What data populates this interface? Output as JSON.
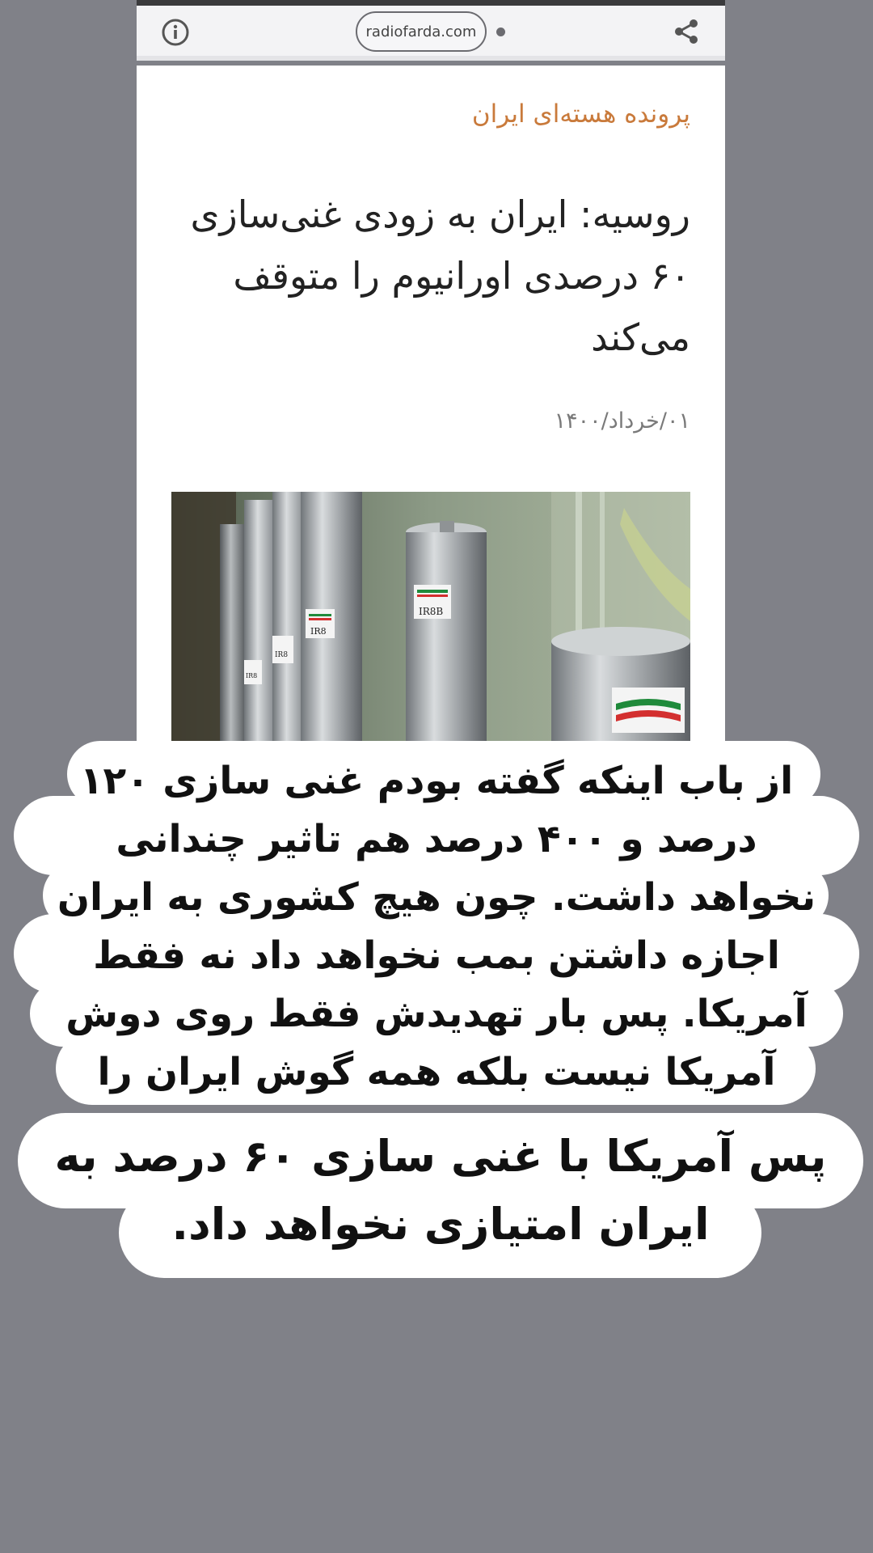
{
  "browser": {
    "url": "radiofarda.com",
    "info_icon": "info-icon",
    "share_icon": "share-icon"
  },
  "article": {
    "category": "پرونده هسته‌ای ایران",
    "headline": "روسیه: ایران به زودی غنی‌سازی ۶۰ درصدی اورانیوم را متوقف می‌کند",
    "date": "۰۱/خرداد/۱۴۰۰",
    "photo_labels": [
      "IR8B",
      "IR8",
      "IR8",
      "IR8",
      "IR8"
    ]
  },
  "overlay": {
    "comment": "از باب اینکه گفته بودم غنی سازی ۱۲۰ درصد و ۴۰۰ درصد هم تاثیر چندانی نخواهد داشت. چون هیچ کشوری به ایران اجازه داشتن بمب نخواهد داد نه فقط آمریکا. پس بار تهدیدش فقط روی دوش آمریکا نیست بلکه همه گوش ایران را خواهند پیچید.",
    "conclusion": "پس آمریکا با غنی سازی ۶۰ درصد به ایران امتیازی نخواهد داد."
  },
  "colors": {
    "page_background": "#808188",
    "category": "#c97a3b",
    "bubble": "#ffffff"
  }
}
